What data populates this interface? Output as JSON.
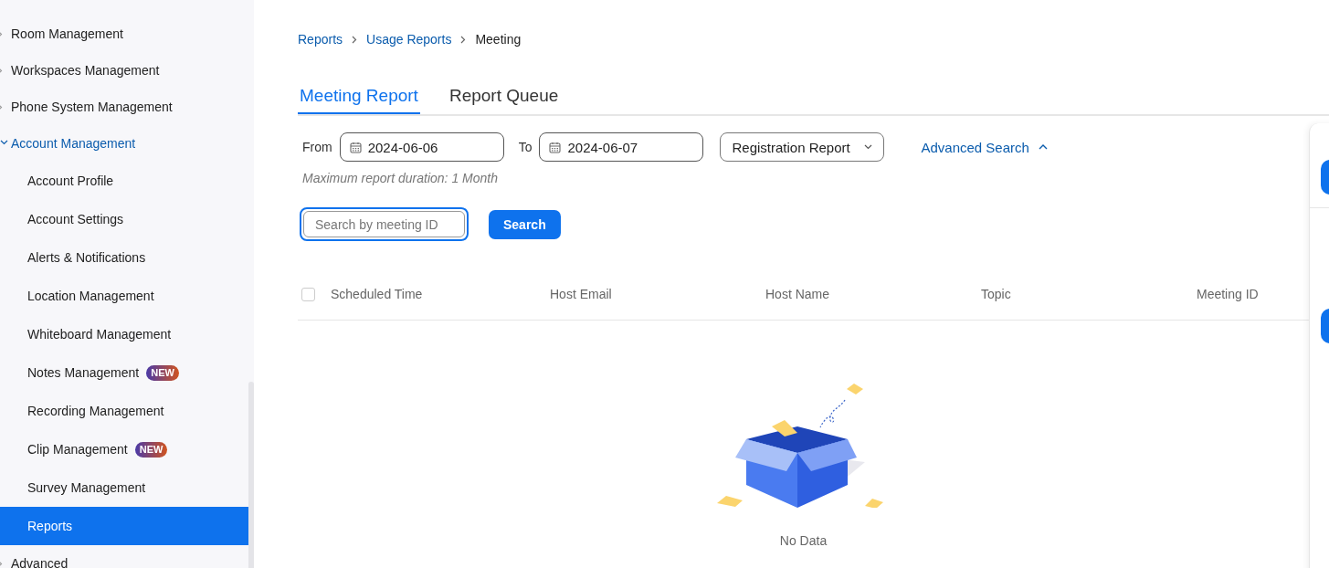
{
  "sidebar": {
    "items": [
      {
        "label": "Room Management",
        "expanded": false
      },
      {
        "label": "Workspaces Management",
        "expanded": false
      },
      {
        "label": "Phone System Management",
        "expanded": false
      },
      {
        "label": "Account Management",
        "expanded": true,
        "children": [
          {
            "label": "Account Profile",
            "selected": false
          },
          {
            "label": "Account Settings",
            "selected": false
          },
          {
            "label": "Alerts & Notifications",
            "selected": false
          },
          {
            "label": "Location Management",
            "selected": false
          },
          {
            "label": "Whiteboard Management",
            "selected": false
          },
          {
            "label": "Notes Management",
            "badge": "NEW",
            "selected": false
          },
          {
            "label": "Recording Management",
            "selected": false
          },
          {
            "label": "Clip Management",
            "badge": "NEW",
            "selected": false
          },
          {
            "label": "Survey Management",
            "selected": false
          },
          {
            "label": "Reports",
            "selected": true
          }
        ]
      },
      {
        "label": "Advanced",
        "expanded": false
      }
    ]
  },
  "breadcrumb": [
    "Reports",
    "Usage Reports",
    "Meeting"
  ],
  "tabs": [
    {
      "label": "Meeting Report",
      "selected": true
    },
    {
      "label": "Report Queue",
      "selected": false
    }
  ],
  "filters": {
    "from_label": "From",
    "from_value": "2024-06-06",
    "to_label": "To",
    "to_value": "2024-06-07",
    "report_type": "Registration Report",
    "advanced_search": {
      "label": "Advanced Search",
      "expanded": true
    },
    "hint": "Maximum report duration: 1 Month"
  },
  "search": {
    "placeholder": "Search by meeting ID",
    "button": "Search"
  },
  "table": {
    "select_all": {
      "checked": false
    },
    "columns": [
      "Scheduled Time",
      "Host Email",
      "Host Name",
      "Topic",
      "Meeting ID"
    ],
    "empty_text": "No Data"
  }
}
